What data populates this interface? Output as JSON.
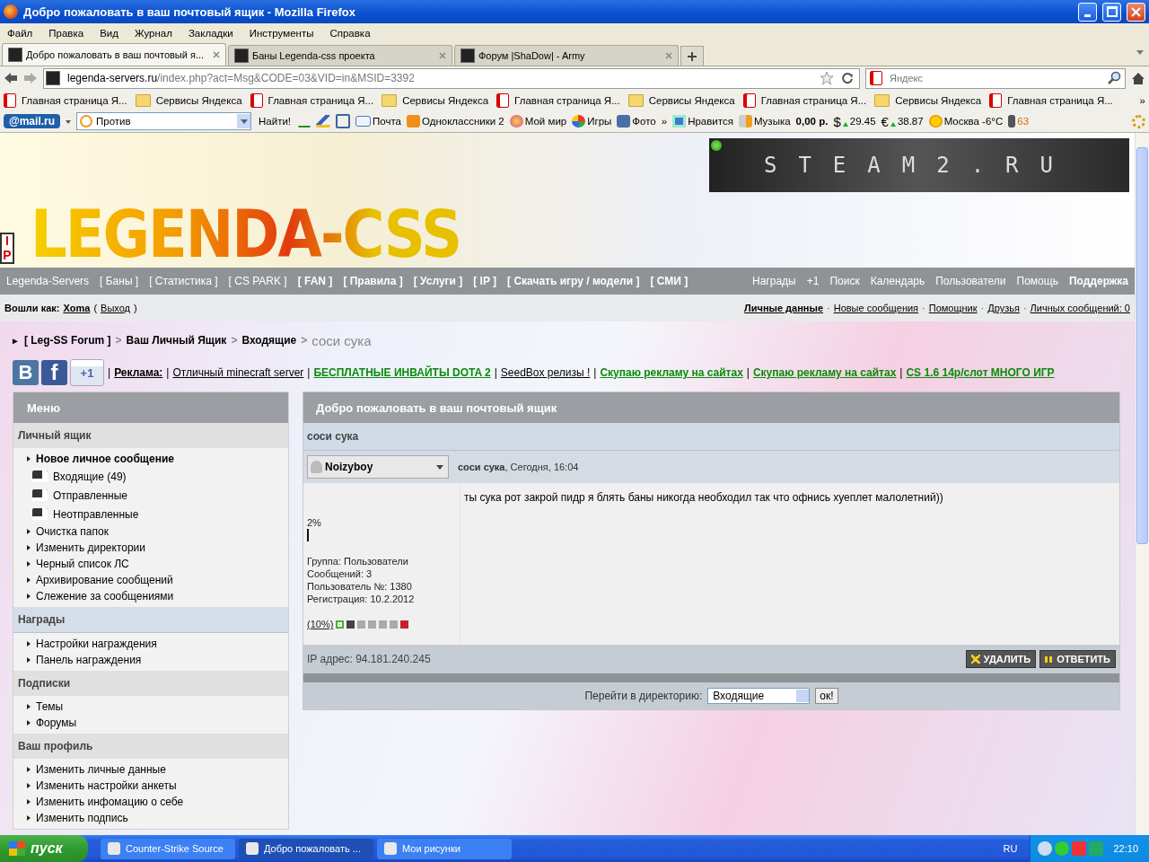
{
  "window": {
    "title": "Добро пожаловать в ваш почтовый ящик - Mozilla Firefox"
  },
  "menu_bar": [
    "Файл",
    "Правка",
    "Вид",
    "Журнал",
    "Закладки",
    "Инструменты",
    "Справка"
  ],
  "tabs": [
    {
      "label": "Добро пожаловать в ваш почтовый я...",
      "selected": true
    },
    {
      "label": "Баны Legenda-css проекта",
      "selected": false
    },
    {
      "label": "Форум |ShaDow| - Army",
      "selected": false
    }
  ],
  "address": {
    "host": "legenda-servers.ru",
    "path": "/index.php?act=Msg&CODE=03&VID=in&MSID=3392"
  },
  "search": {
    "placeholder": "Яндекс"
  },
  "bookmarks": [
    {
      "label": "Главная страница Я...",
      "kind": "yandex"
    },
    {
      "label": "Сервисы Яндекса",
      "kind": "folder"
    },
    {
      "label": "Главная страница Я...",
      "kind": "yandex"
    },
    {
      "label": "Сервисы Яндекса",
      "kind": "folder"
    },
    {
      "label": "Главная страница Я...",
      "kind": "yandex"
    },
    {
      "label": "Сервисы Яндекса",
      "kind": "folder"
    },
    {
      "label": "Главная страница Я...",
      "kind": "yandex"
    },
    {
      "label": "Сервисы Яндекса",
      "kind": "folder"
    },
    {
      "label": "Главная страница Я...",
      "kind": "yandex"
    }
  ],
  "bookmarks_more": "»",
  "mail_toolbar": {
    "logo": "@mail.ru",
    "query": "Против",
    "find": "Найти!",
    "items": [
      {
        "label": "Почта",
        "kind": "mail"
      },
      {
        "label": "Одноклассники 2",
        "kind": "ok"
      },
      {
        "label": "Мой мир",
        "kind": "world"
      },
      {
        "label": "Игры",
        "kind": "games"
      },
      {
        "label": "Фото",
        "kind": "photo"
      },
      {
        "label": "»",
        "kind": "more"
      },
      {
        "label": "Нравится",
        "kind": "like"
      },
      {
        "label": "Музыка",
        "kind": "music"
      },
      {
        "label": "0,00 р.",
        "kind": "money"
      },
      {
        "label": "29.45",
        "kind": "currency",
        "symbol": "$"
      },
      {
        "label": "38.87",
        "kind": "currency",
        "symbol": "€"
      },
      {
        "label": "Москва -6°C",
        "kind": "weather"
      },
      {
        "label": "63",
        "kind": "traffic"
      }
    ]
  },
  "banner": {
    "logo": "LEGENDA-CSS",
    "side_tag": "IP",
    "ad": "STEAM2.RU"
  },
  "nav_left": [
    {
      "label": "Legenda-Servers",
      "bold": false
    },
    {
      "label": "[ Баны ]",
      "bold": false
    },
    {
      "label": "[ Статистика ]",
      "bold": false
    },
    {
      "label": "[ CS PARK ]",
      "bold": false
    },
    {
      "label": "[ FAN ]",
      "bold": true
    },
    {
      "label": "[ Правила ]",
      "bold": true
    },
    {
      "label": "[ Услуги ]",
      "bold": true
    },
    {
      "label": "[ IP ]",
      "bold": true
    },
    {
      "label": "[ Скачать игру / модели ]",
      "bold": true
    },
    {
      "label": "[ СМИ ]",
      "bold": true
    }
  ],
  "nav_right": [
    {
      "label": "Награды",
      "bold": false
    },
    {
      "label": "+1",
      "bold": false
    },
    {
      "label": "Поиск",
      "bold": false
    },
    {
      "label": "Календарь",
      "bold": false
    },
    {
      "label": "Пользователи",
      "bold": false
    },
    {
      "label": "Помощь",
      "bold": false
    },
    {
      "label": "Поддержка",
      "bold": true
    }
  ],
  "login": {
    "label": "Вошли как:",
    "user": "Xoma",
    "open": "(",
    "logout": "Выход",
    "close": ")"
  },
  "user_links": [
    {
      "label": "Личные данные",
      "bold": true
    },
    {
      "label": "Новые сообщения",
      "bold": false
    },
    {
      "label": "Помощник",
      "bold": false
    },
    {
      "label": "Друзья",
      "bold": false
    },
    {
      "label": "Личных сообщений: 0",
      "bold": false
    }
  ],
  "user_links_separator": "·",
  "breadcrumb": {
    "marker": "►",
    "separator": ">",
    "items": [
      {
        "label": "[ Leg-SS Forum ]",
        "current": false
      },
      {
        "label": "Ваш Личный Ящик",
        "current": false
      },
      {
        "label": "Входящие",
        "current": false
      },
      {
        "label": "соси сука",
        "current": true
      }
    ]
  },
  "social": {
    "vk": "В",
    "fb": "f",
    "plus": "+1"
  },
  "ads": {
    "separator": "|",
    "label": "Реклама:",
    "links": [
      {
        "text": "Отличный minecraft server",
        "kind": "plain"
      },
      {
        "text": "БЕСПЛАТНЫЕ ИНВАЙТЫ DOTA 2",
        "kind": "promo"
      },
      {
        "text": "SeedBox релизы !",
        "kind": "plain"
      },
      {
        "text": "Скупаю рекламу на сайтах",
        "kind": "promo"
      },
      {
        "text": "Скупаю рекламу на сайтах",
        "kind": "promo"
      },
      {
        "text": "CS 1.6 14р/слот МНОГО ИГР",
        "kind": "promo"
      }
    ]
  },
  "sidebar": {
    "title": "Меню",
    "sections": [
      {
        "title": "Личный ящик",
        "highlighted": false,
        "items": [
          {
            "label": "Новое личное сообщение",
            "kind": "bullet",
            "bold": true
          },
          {
            "label": "Входящие (49)",
            "kind": "folder",
            "bold": false
          },
          {
            "label": "Отправленные",
            "kind": "folder",
            "bold": false
          },
          {
            "label": "Неотправленные",
            "kind": "folder",
            "bold": false
          },
          {
            "label": "Очистка папок",
            "kind": "bullet",
            "bold": false
          },
          {
            "label": "Изменить директории",
            "kind": "bullet",
            "bold": false
          },
          {
            "label": "Черный список ЛС",
            "kind": "bullet",
            "bold": false
          },
          {
            "label": "Архивирование сообщений",
            "kind": "bullet",
            "bold": false
          },
          {
            "label": "Слежение за сообщениями",
            "kind": "bullet",
            "bold": false
          }
        ]
      },
      {
        "title": "Награды",
        "highlighted": true,
        "items": [
          {
            "label": "Настройки награждения",
            "kind": "bullet",
            "bold": false
          },
          {
            "label": "Панель награждения",
            "kind": "bullet",
            "bold": false
          }
        ]
      },
      {
        "title": "Подписки",
        "highlighted": false,
        "items": [
          {
            "label": "Темы",
            "kind": "bullet",
            "bold": false
          },
          {
            "label": "Форумы",
            "kind": "bullet",
            "bold": false
          }
        ]
      },
      {
        "title": "Ваш профиль",
        "highlighted": false,
        "items": [
          {
            "label": "Изменить личные данные",
            "kind": "bullet",
            "bold": false
          },
          {
            "label": "Изменить настройки анкеты",
            "kind": "bullet",
            "bold": false
          },
          {
            "label": "Изменить инфомацию о себе",
            "kind": "bullet",
            "bold": false
          },
          {
            "label": "Изменить подпись",
            "kind": "bullet",
            "bold": false
          }
        ]
      }
    ]
  },
  "main": {
    "title": "Добро пожаловать в ваш почтовый ящик",
    "subject": "соси сука",
    "author": "Noizyboy",
    "post_meta": "**соси сука**, Сегодня, 16:04",
    "body": "ты сука рот закрой пидр я блять баны никогда необходил так что офнись хуеплет малолетний))",
    "warn": {
      "label": "2%"
    },
    "info": [
      "Группа: Пользователи",
      "Сообщений: 3",
      "Пользователь №: 1380",
      "Регистрация: 10.2.2012"
    ],
    "reputation": "(10%)",
    "ip": "IP адрес: 94.181.240.245",
    "actions": [
      {
        "label": "УДАЛИТЬ",
        "kind": "delete"
      },
      {
        "label": "ОТВЕТИТЬ",
        "kind": "reply"
      }
    ],
    "jump": {
      "label": "Перейти в директорию:",
      "value": "Входящие",
      "button": "ок!"
    }
  },
  "taskbar": {
    "start": "пуск",
    "tasks": [
      {
        "label": "Counter-Strike Source",
        "selected": false
      },
      {
        "label": "Добро пожаловать ...",
        "selected": true
      },
      {
        "label": "Мои рисунки",
        "selected": false
      }
    ],
    "lang": "RU",
    "time": "22:10"
  }
}
